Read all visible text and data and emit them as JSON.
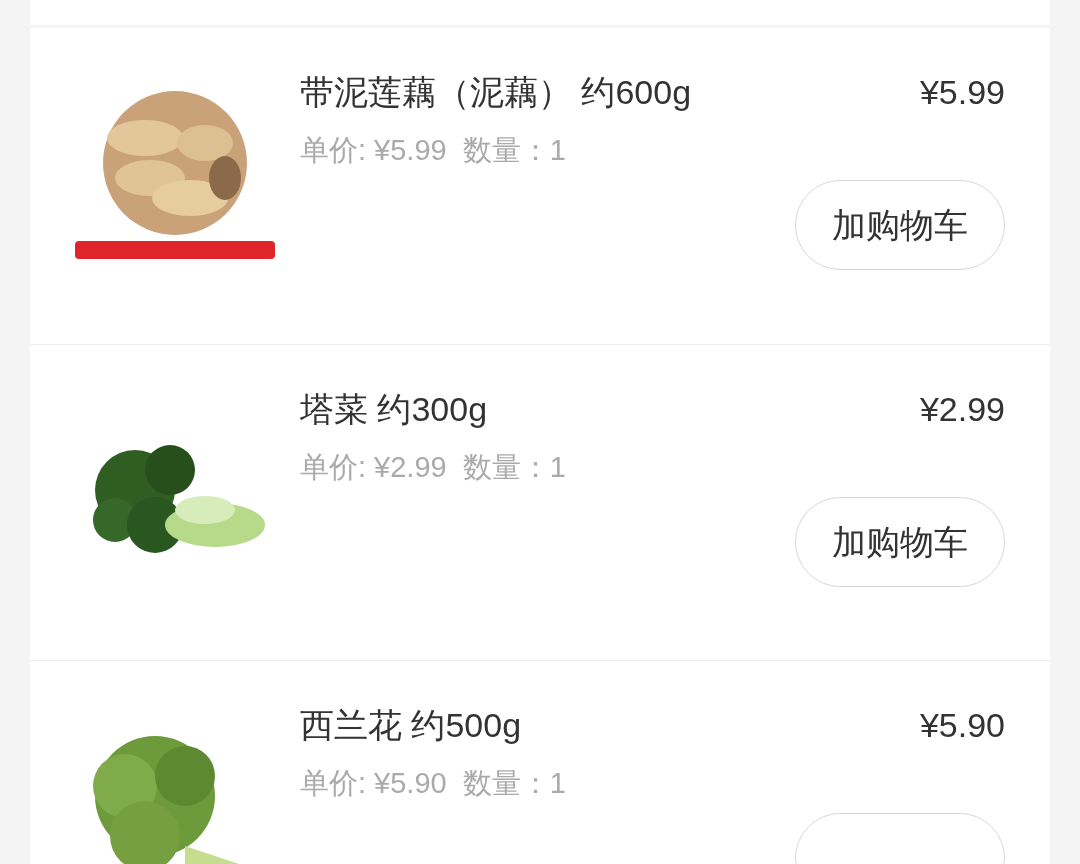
{
  "items": [
    {
      "name": "带泥莲藕（泥藕） 约600g",
      "price": "¥5.99",
      "unit_price": "单价: ¥5.99",
      "quantity": "数量：1",
      "button": "加购物车"
    },
    {
      "name": "塔菜 约300g",
      "price": "¥2.99",
      "unit_price": "单价: ¥2.99",
      "quantity": "数量：1",
      "button": "加购物车"
    },
    {
      "name": "西兰花 约500g",
      "price": "¥5.90",
      "unit_price": "单价: ¥5.90",
      "quantity": "数量：1"
    }
  ]
}
